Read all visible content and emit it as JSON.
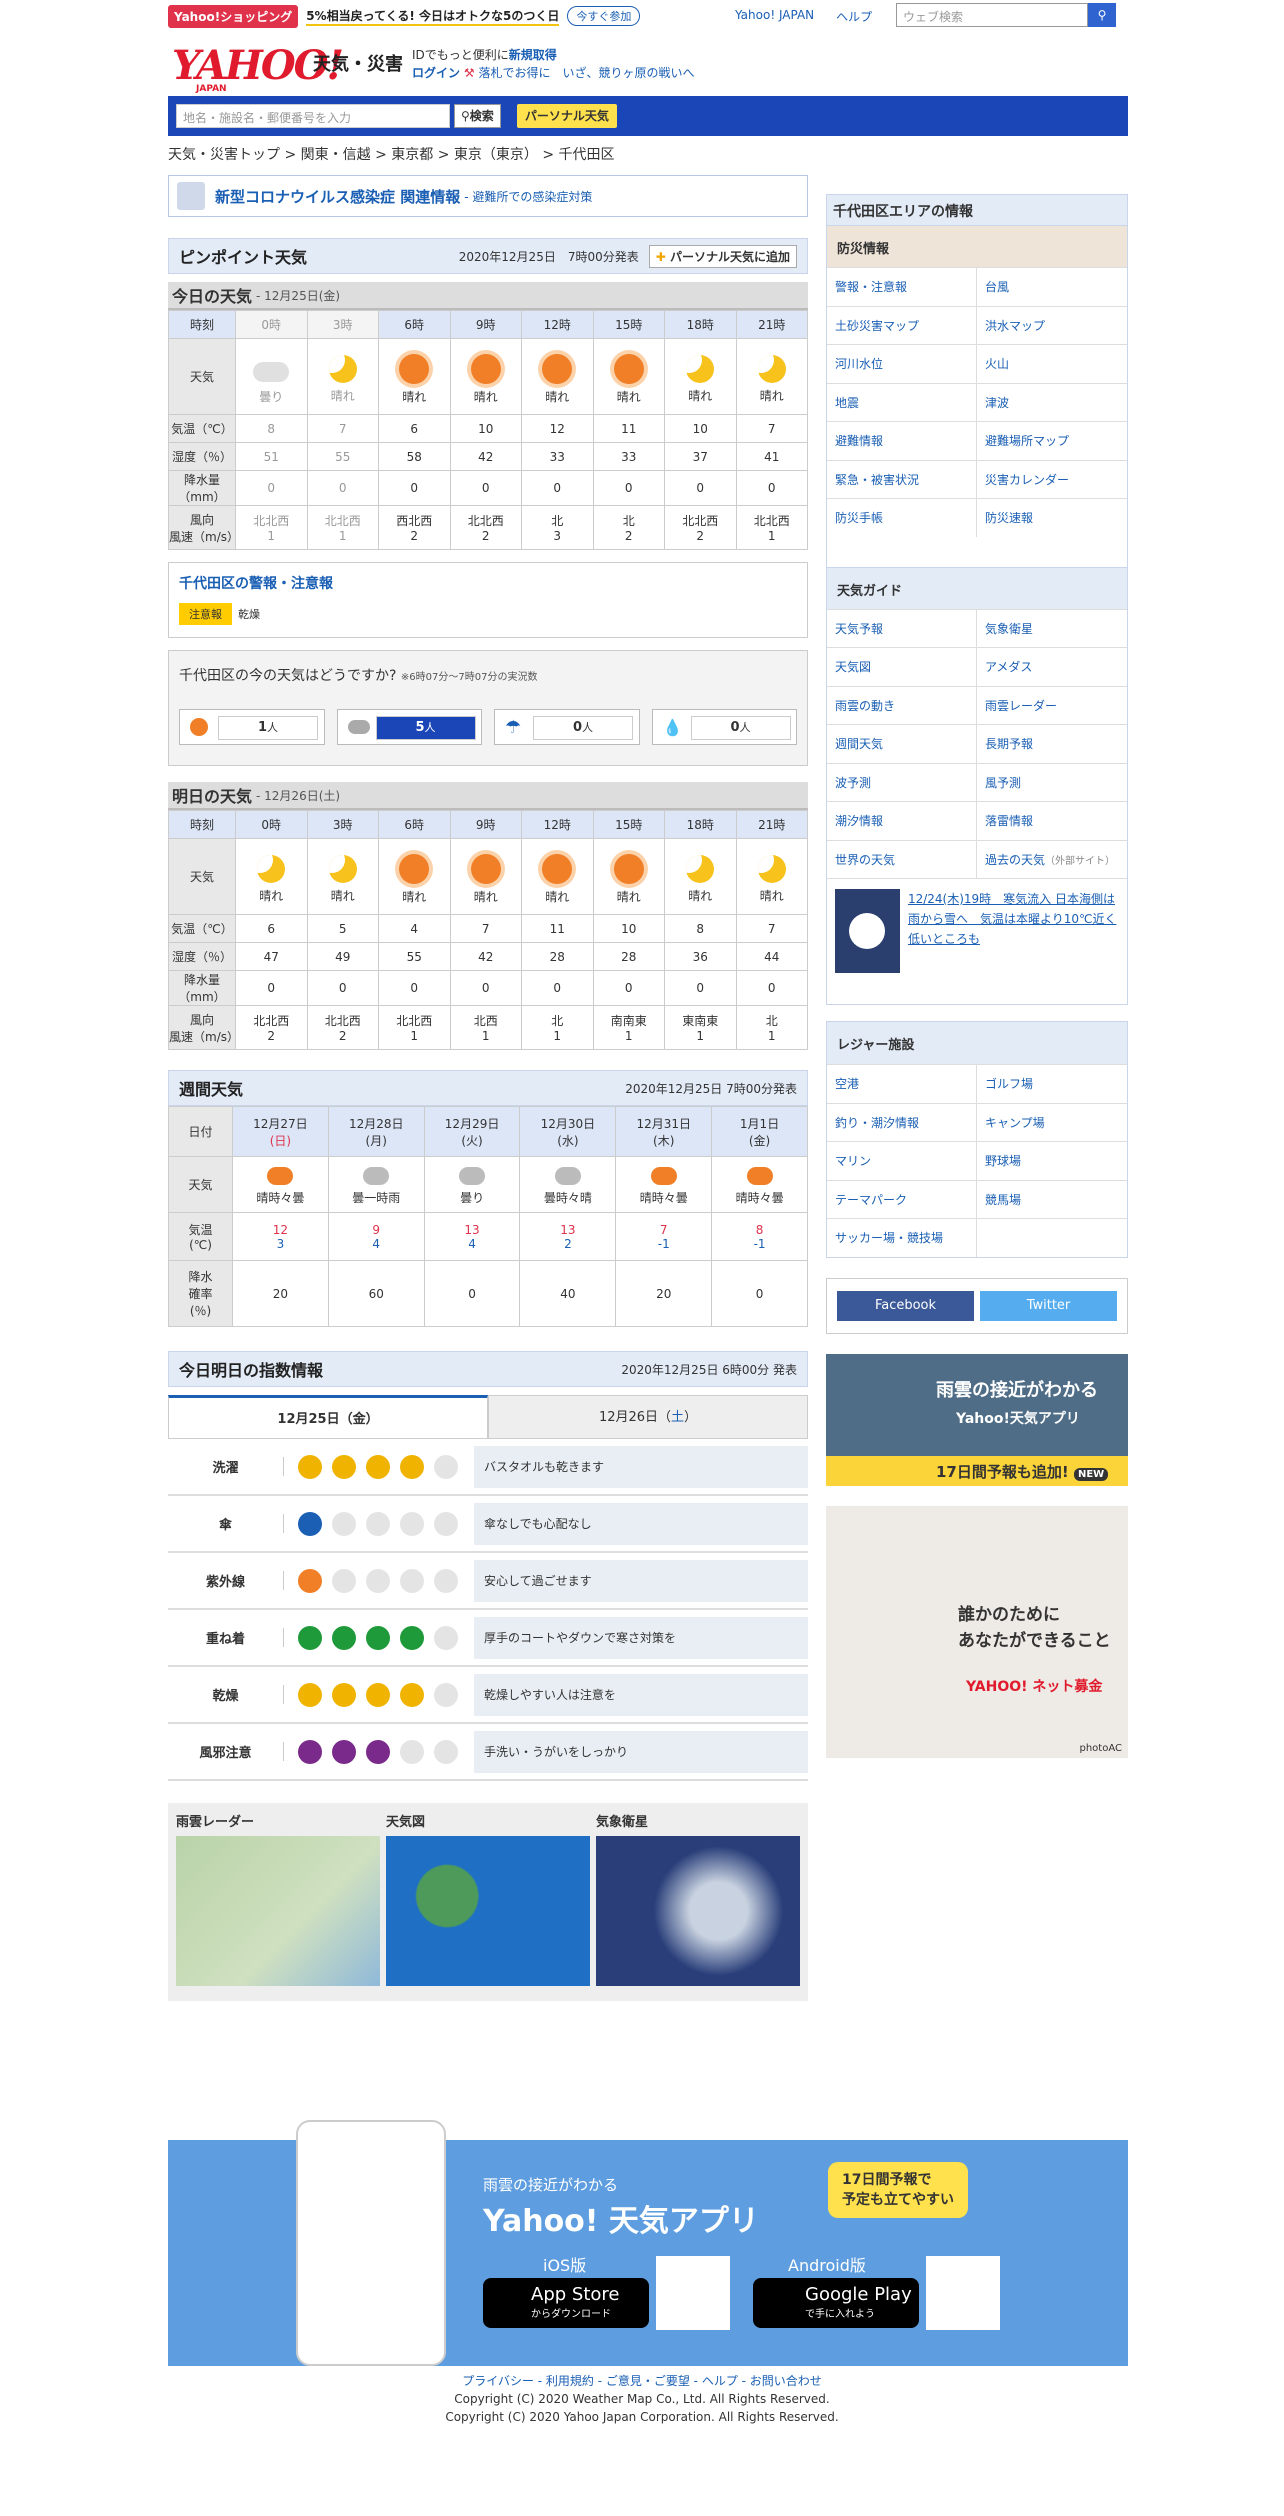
{
  "promo": {
    "tag": "Yahoo!ショッピング",
    "msg": "5%相当戻ってくる! 今日はオトクな5のつく日",
    "join": "今すぐ参加",
    "links": [
      "Yahoo! JAPAN",
      "ヘルプ"
    ],
    "search_placeholder": "ウェブ検索"
  },
  "header": {
    "logo": "YAHOO!",
    "logo_sub": "JAPAN",
    "service": "天気・災害",
    "line1a": "IDでもっと便利に",
    "line1b": "新規取得",
    "login": "ログイン",
    "line2": "落札でお得に　いざ、競りヶ原の戦いへ"
  },
  "nav": {
    "placeholder": "地名・施設名・郵便番号を入力",
    "search": "検索",
    "personal": "パーソナル天気"
  },
  "breadcrumb": "天気・災害トップ > 関東・信越 > 東京都 > 東京（東京） > 千代田区",
  "covid": {
    "title": "新型コロナウイルス感染症 関連情報",
    "sub": "- 避難所での感染症対策"
  },
  "pinpoint": {
    "title": "ピンポイント天気",
    "issued": "2020年12月25日　7時00分発表",
    "add": "パーソナル天気に追加"
  },
  "today": {
    "title": "今日の天気",
    "date": "- 12月25日(金)",
    "times": [
      "0時",
      "3時",
      "6時",
      "9時",
      "12時",
      "15時",
      "18時",
      "21時"
    ],
    "weather": [
      "曇り",
      "晴れ",
      "晴れ",
      "晴れ",
      "晴れ",
      "晴れ",
      "晴れ",
      "晴れ"
    ],
    "temp": [
      "8",
      "7",
      "6",
      "10",
      "12",
      "11",
      "10",
      "7"
    ],
    "hum": [
      "51",
      "55",
      "58",
      "42",
      "33",
      "33",
      "37",
      "41"
    ],
    "rain": [
      "0",
      "0",
      "0",
      "0",
      "0",
      "0",
      "0",
      "0"
    ],
    "dir": [
      "北北西",
      "北北西",
      "西北西",
      "北北西",
      "北",
      "北",
      "北北西",
      "北北西"
    ],
    "speed": [
      "1",
      "1",
      "2",
      "2",
      "3",
      "2",
      "2",
      "1"
    ]
  },
  "labels": {
    "time": "時刻",
    "weather": "天気",
    "temp": "気温（℃）",
    "hum": "湿度（％）",
    "rain": "降水量（mm）",
    "wind1": "風向",
    "wind2": "風速（m/s）"
  },
  "alert": {
    "title": "千代田区の警報・注意報",
    "badge": "注意報",
    "text": "乾燥"
  },
  "poll": {
    "q": "千代田区の今の天気はどうですか?",
    "note": "※6時07分～7時07分の実況数",
    "counts": [
      "1",
      "5",
      "0",
      "0"
    ],
    "unit": "人"
  },
  "tomorrow": {
    "title": "明日の天気",
    "date": "- 12月26日(土)",
    "times": [
      "0時",
      "3時",
      "6時",
      "9時",
      "12時",
      "15時",
      "18時",
      "21時"
    ],
    "weather": [
      "晴れ",
      "晴れ",
      "晴れ",
      "晴れ",
      "晴れ",
      "晴れ",
      "晴れ",
      "晴れ"
    ],
    "temp": [
      "6",
      "5",
      "4",
      "7",
      "11",
      "10",
      "8",
      "7"
    ],
    "hum": [
      "47",
      "49",
      "55",
      "42",
      "28",
      "28",
      "36",
      "44"
    ],
    "rain": [
      "0",
      "0",
      "0",
      "0",
      "0",
      "0",
      "0",
      "0"
    ],
    "dir": [
      "北北西",
      "北北西",
      "北北西",
      "北西",
      "北",
      "南南東",
      "東南東",
      "北"
    ],
    "speed": [
      "2",
      "2",
      "1",
      "1",
      "1",
      "1",
      "1",
      "1"
    ]
  },
  "weekly": {
    "title": "週間天気",
    "issued": "2020年12月25日 7時00分発表",
    "date_label": "日付",
    "weather_label": "天気",
    "temp_label1": "気温",
    "temp_label2": "(℃)",
    "rain_label1": "降水",
    "rain_label2": "確率",
    "rain_label3": "(％)",
    "dates": [
      "12月27日",
      "12月28日",
      "12月29日",
      "12月30日",
      "12月31日",
      "1月1日"
    ],
    "dows": [
      "(日)",
      "(月)",
      "(火)",
      "(水)",
      "(木)",
      "(金)"
    ],
    "weather": [
      "晴時々曇",
      "曇一時雨",
      "曇り",
      "曇時々晴",
      "晴時々曇",
      "晴時々曇"
    ],
    "high": [
      "12",
      "9",
      "13",
      "13",
      "7",
      "8"
    ],
    "low": [
      "3",
      "4",
      "4",
      "2",
      "-1",
      "-1"
    ],
    "pop": [
      "20",
      "60",
      "0",
      "40",
      "20",
      "0"
    ]
  },
  "index": {
    "title": "今日明日の指数情報",
    "issued": "2020年12月25日 6時00分 発表",
    "tab1": "12月25日（金）",
    "tab2a": "12月26日（",
    "tab2b": "土",
    "tab2c": "）",
    "rows": [
      {
        "label": "洗濯",
        "desc": "バスタオルも乾きます"
      },
      {
        "label": "傘",
        "desc": "傘なしでも心配なし"
      },
      {
        "label": "紫外線",
        "desc": "安心して過ごせます"
      },
      {
        "label": "重ね着",
        "desc": "厚手のコートやダウンで寒さ対策を"
      },
      {
        "label": "乾燥",
        "desc": "乾燥しやすい人は注意を"
      },
      {
        "label": "風邪注意",
        "desc": "手洗い・うがいをしっかり"
      }
    ]
  },
  "maps": {
    "radar": "雨雲レーダー",
    "chart": "天気図",
    "sat": "気象衛星"
  },
  "side": {
    "area_title": "千代田区エリアの情報",
    "disaster": "防災情報",
    "disaster_links": [
      "警報・注意報",
      "台風",
      "土砂災害マップ",
      "洪水マップ",
      "河川水位",
      "火山",
      "地震",
      "津波",
      "避難情報",
      "避難場所マップ",
      "緊急・被害状況",
      "災害カレンダー",
      "防災手帳",
      "防災速報"
    ],
    "guide": "天気ガイド",
    "guide_links": [
      "天気予報",
      "気象衛星",
      "天気図",
      "アメダス",
      "雨雲の動き",
      "雨雲レーダー",
      "週間天気",
      "長期予報",
      "波予測",
      "風予測",
      "潮汐情報",
      "落雷情報",
      "世界の天気",
      "過去の天気"
    ],
    "external": "（外部サイト）",
    "news": "12/24(木)19時　寒気流入 日本海側は雨から雪へ　気温は本曜より10℃近く低いところも",
    "leisure": "レジャー施設",
    "leisure_links": [
      "空港",
      "ゴルフ場",
      "釣り・潮汐情報",
      "キャンプ場",
      "マリン",
      "野球場",
      "テーマパーク",
      "競馬場",
      "サッカー場・競技場",
      ""
    ],
    "fb": "Facebook",
    "tw": "Twitter"
  },
  "ad1": {
    "t1": "雨雲の接近がわかる",
    "t2": "Yahoo!天気アプリ",
    "t3": "17日間予報も追加!",
    "new": "NEW"
  },
  "ad2": {
    "t1": "誰かのために",
    "t2": "あなたができること",
    "brand": "YAHOO! ネット募金",
    "credit": "photoAC"
  },
  "footer_ad": {
    "t1": "雨雲の接近がわかる",
    "t2": "Yahoo! 天気アプリ",
    "badge1": "17日間予報で",
    "badge2": "予定も立てやすい",
    "ios": "iOS版",
    "android": "Android版",
    "appstore": "App Store",
    "appstore_sub": "からダウンロード",
    "gplay": "Google Play",
    "gplay_sub": "で手に入れよう"
  },
  "footer": {
    "links": "プライバシー - 利用規約 - ご意見・ご要望 - ヘルプ - お問い合わせ",
    "c1": "Copyright (C) 2020 Weather Map Co., Ltd. All Rights Reserved.",
    "c2": "Copyright (C) 2020 Yahoo Japan Corporation. All Rights Reserved."
  }
}
